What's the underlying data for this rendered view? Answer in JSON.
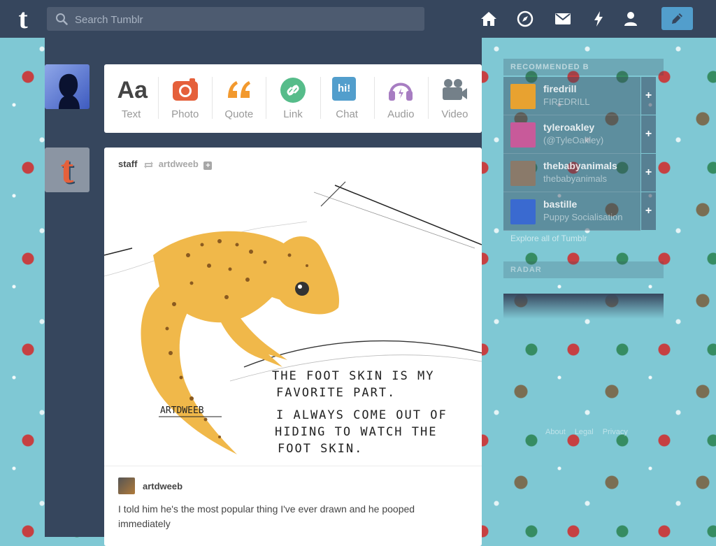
{
  "search": {
    "placeholder": "Search Tumblr"
  },
  "nav": {
    "icons": [
      "home-icon",
      "explore-icon",
      "inbox-icon",
      "activity-icon",
      "account-icon"
    ],
    "compose_icon": "pencil-icon"
  },
  "post_types": [
    {
      "label": "Text",
      "glyph": "Aa",
      "color": "#444444"
    },
    {
      "label": "Photo",
      "color": "#e5603b"
    },
    {
      "label": "Quote",
      "color": "#f2992e"
    },
    {
      "label": "Link",
      "color": "#56bc8a"
    },
    {
      "label": "Chat",
      "glyph": "hi!",
      "color": "#529ecc"
    },
    {
      "label": "Audio",
      "color": "#a77dc2"
    },
    {
      "label": "Video",
      "color": "#748089"
    }
  ],
  "post": {
    "author": "staff",
    "source": "artdweeb",
    "follow_glyph": "+",
    "image": {
      "lines": [
        "THE FOOT SKIN IS MY",
        "FAVORITE PART.",
        "I ALWAYS COME OUT OF",
        "HIDING TO WATCH THE",
        "FOOT SKIN."
      ],
      "signature": "ARTDWEEB"
    },
    "caption_author": "artdweeb",
    "caption": "I told him he's the most popular thing I've ever drawn and he pooped immediately"
  },
  "sidebar": {
    "title": "RECOMMENDED B",
    "blogs": [
      {
        "name": "firedrill",
        "title": "FIREDRILL",
        "color": "#e8a230"
      },
      {
        "name": "tyleroakley",
        "title": "(@TyleOakley)",
        "color": "#c85a9a"
      },
      {
        "name": "thebabyanimals",
        "title": "thebabyanimals",
        "color": "#8a7a6a"
      },
      {
        "name": "bastille",
        "title": "Puppy Socialisation",
        "color": "#3a6ad0"
      }
    ],
    "follow_glyph": "+",
    "explore": "Explore all of Tumblr",
    "radar_title": "RADAR",
    "footer": [
      "About",
      "Legal",
      "Privacy"
    ]
  }
}
